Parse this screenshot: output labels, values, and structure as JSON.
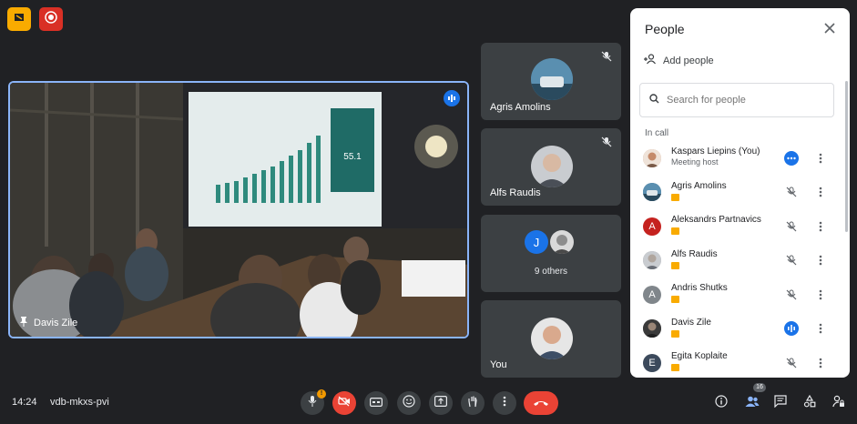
{
  "colors": {
    "background": "#202124",
    "tile": "#3c4043",
    "accent_blue": "#1a73e8",
    "active_border": "#8ab4f8",
    "end_call_red": "#ea4335",
    "host_badge_yellow": "#f9ab00"
  },
  "top_badges": [
    {
      "icon": "document-icon",
      "color": "#f9ab00"
    },
    {
      "icon": "recording-icon",
      "color": "#d93025"
    }
  ],
  "stage": {
    "name": "Davis Zile",
    "icon": "pin-icon"
  },
  "tiles": [
    {
      "name": "Agris Amolins",
      "muted": true
    },
    {
      "name": "Alfs Raudis",
      "muted": true
    },
    {
      "name": "9 others",
      "avatar_initial": "J"
    },
    {
      "name": "You"
    }
  ],
  "people_panel": {
    "title": "People",
    "add_people_label": "Add people",
    "search_placeholder": "Search for people",
    "section_label": "In call",
    "people": [
      {
        "name": "Kaspars Liepins (You)",
        "sub": "Meeting host",
        "initial": "",
        "avatar_color": "#c58b6b",
        "status": "speaking"
      },
      {
        "name": "Agris Amolins",
        "sub": "",
        "initial": "",
        "avatar_color": "#3b6e8f",
        "status": "muted"
      },
      {
        "name": "Aleksandrs Partnavics",
        "sub": "",
        "initial": "A",
        "avatar_color": "#c5221f",
        "status": "muted"
      },
      {
        "name": "Alfs Raudis",
        "sub": "",
        "initial": "",
        "avatar_color": "#9aa0a6",
        "status": "muted"
      },
      {
        "name": "Andris Shutks",
        "sub": "",
        "initial": "A",
        "avatar_color": "#80868b",
        "status": "muted"
      },
      {
        "name": "Davis Zile",
        "sub": "",
        "initial": "",
        "avatar_color": "#5f6368",
        "status": "speaking"
      },
      {
        "name": "Egita Koplaite",
        "sub": "",
        "initial": "E",
        "avatar_color": "#3c4a5c",
        "status": "muted"
      }
    ]
  },
  "bottom_bar": {
    "time": "14:24",
    "meeting_code": "vdb-mkxs-pvi",
    "mic_warning": "!",
    "participant_count": "16"
  }
}
